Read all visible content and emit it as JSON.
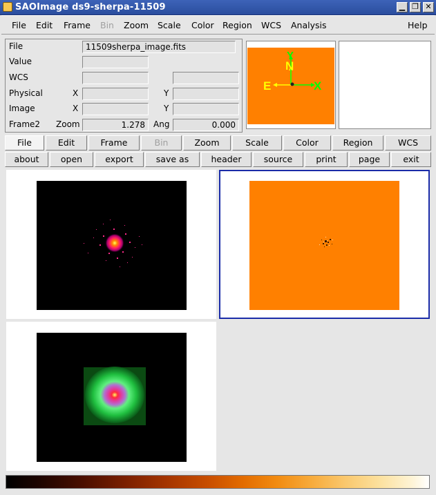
{
  "window": {
    "title": "SAOImage ds9-sherpa-11509",
    "controls": {
      "minimize": "▁",
      "maximize": "❐",
      "close": "✕"
    }
  },
  "menubar": {
    "items": [
      {
        "label": "File",
        "enabled": true
      },
      {
        "label": "Edit",
        "enabled": true
      },
      {
        "label": "Frame",
        "enabled": true
      },
      {
        "label": "Bin",
        "enabled": false
      },
      {
        "label": "Zoom",
        "enabled": true
      },
      {
        "label": "Scale",
        "enabled": true
      },
      {
        "label": "Color",
        "enabled": true
      },
      {
        "label": "Region",
        "enabled": true
      },
      {
        "label": "WCS",
        "enabled": true
      },
      {
        "label": "Analysis",
        "enabled": true
      },
      {
        "label": "Help",
        "enabled": true
      }
    ]
  },
  "info": {
    "file_label": "File",
    "file_value": "11509sherpa_image.fits",
    "value_label": "Value",
    "value_value": "",
    "wcs_label": "WCS",
    "wcs_value_1": "",
    "wcs_value_2": "",
    "physical_label": "Physical",
    "physical_x_label": "X",
    "physical_x_value": "",
    "physical_y_label": "Y",
    "physical_y_value": "",
    "image_label": "Image",
    "image_x_label": "X",
    "image_x_value": "",
    "image_y_label": "Y",
    "image_y_value": "",
    "frame_label": "Frame2",
    "zoom_label": "Zoom",
    "zoom_value": "1.278",
    "angle_label": "Ang",
    "angle_value": "0.000"
  },
  "panner": {
    "compass_north": "N",
    "compass_east": "E",
    "compass_x": "X",
    "compass_y": "Y",
    "background_color": "#ff8000",
    "compass_color_wcs": "#ffff00",
    "compass_color_image": "#00ff00"
  },
  "buttonbar_top": {
    "buttons": [
      {
        "label": "File",
        "active": true,
        "enabled": true
      },
      {
        "label": "Edit",
        "active": false,
        "enabled": true
      },
      {
        "label": "Frame",
        "active": false,
        "enabled": true
      },
      {
        "label": "Bin",
        "active": false,
        "enabled": false
      },
      {
        "label": "Zoom",
        "active": false,
        "enabled": true
      },
      {
        "label": "Scale",
        "active": false,
        "enabled": true
      },
      {
        "label": "Color",
        "active": false,
        "enabled": true
      },
      {
        "label": "Region",
        "active": false,
        "enabled": true
      },
      {
        "label": "WCS",
        "active": false,
        "enabled": true
      }
    ]
  },
  "buttonbar_bottom": {
    "buttons": [
      {
        "label": "about"
      },
      {
        "label": "open"
      },
      {
        "label": "export"
      },
      {
        "label": "save as"
      },
      {
        "label": "header"
      },
      {
        "label": "source"
      },
      {
        "label": "print"
      },
      {
        "label": "page"
      },
      {
        "label": "exit"
      }
    ]
  },
  "frames": [
    {
      "name": "frame-1",
      "colormap": "heat",
      "current": false
    },
    {
      "name": "frame-2",
      "colormap": "orange-residual",
      "current": true
    },
    {
      "name": "frame-3",
      "colormap": "green-smoothed",
      "current": false
    }
  ],
  "colors": {
    "current_frame_border": "#1a2ba8",
    "title_bar": "#2f54aa"
  }
}
